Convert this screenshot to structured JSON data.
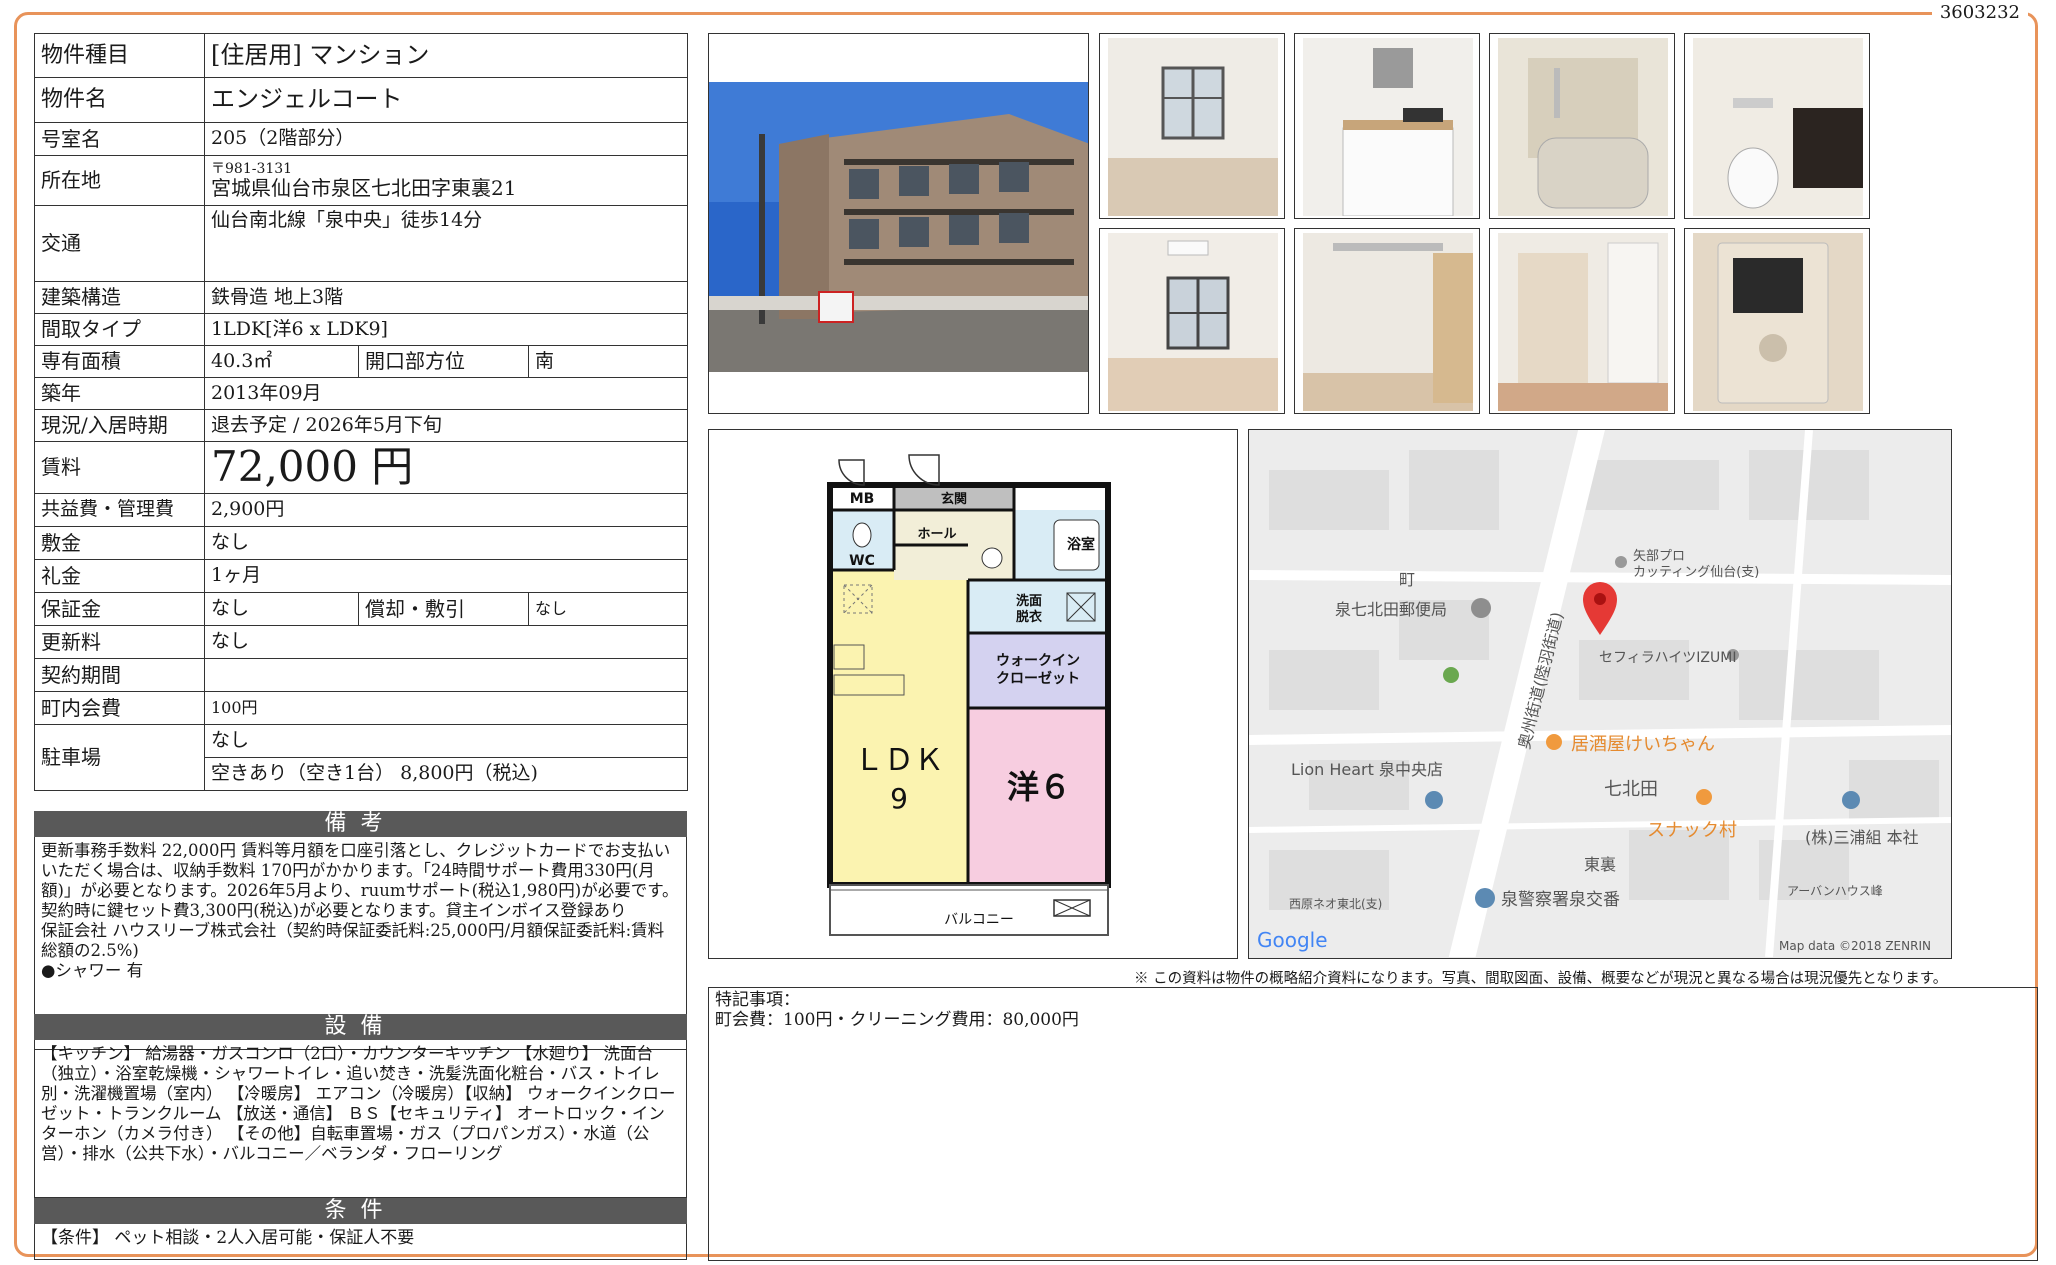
{
  "doc_id": "3603232",
  "spec": {
    "type_label": "物件種目",
    "type_value": "[住居用]  マンション",
    "name_label": "物件名",
    "name_value": "エンジェルコート",
    "room_label": "号室名",
    "room_value": "205（2階部分）",
    "address_label": "所在地",
    "address_zip": "〒981-3131",
    "address_value": "宮城県仙台市泉区七北田字東裏21",
    "access_label": "交通",
    "access_value": "仙台南北線「泉中央」徒歩14分",
    "structure_label": "建築構造",
    "structure_value": "鉄骨造 地上3階",
    "layout_label": "間取タイプ",
    "layout_value": "1LDK[洋6 x LDK9]",
    "area_label": "専有面積",
    "area_value": "40.3㎡",
    "opening_label": "開口部方位",
    "opening_value": "南",
    "built_label": "築年",
    "built_value": "2013年09月",
    "status_label": "現況/入居時期",
    "status_value": "退去予定  /  2026年5月下旬",
    "rent_label": "賃料",
    "rent_value": "72,000 円",
    "fee_label": "共益費・管理費",
    "fee_value": "2,900円",
    "deposit_label": "敷金",
    "deposit_value": "なし",
    "keymoney_label": "礼金",
    "keymoney_value": "1ヶ月",
    "guarantee_label": "保証金",
    "guarantee_value": "なし",
    "amort_label": "償却・敷引",
    "amort_value": "なし",
    "renewal_label": "更新料",
    "renewal_value": "なし",
    "contract_label": "契約期間",
    "contract_value": "",
    "town_label": "町内会費",
    "town_value": "100円",
    "parking_label": "駐車場",
    "parking_value1": "なし",
    "parking_value2": "空きあり（空き1台） 8,800円（税込)"
  },
  "bikou": {
    "title": "備考",
    "text": "更新事務手数料 22,000円 賃料等月額を口座引落とし、クレジットカードでお支払いいただく場合は、収納手数料 170円がかかります。「24時間サポート費用330円(月額)」が必要となります。2026年5月より、ruumサポート(税込1,980円)が必要です。契約時に鍵セット費3,300円(税込)が必要となります。貸主インボイス登録あり",
    "guarantor": "保証会社 ハウスリーブ株式会社（契約時保証委託料:25,000円/月額保証委託料:賃料総額の2.5%)",
    "shower": "●シャワー 有"
  },
  "setsubi": {
    "title": "設備",
    "text": "【キッチン】 給湯器・ガスコンロ（2口）・カウンターキッチン 【水廻り】 洗面台（独立）・浴室乾燥機・シャワートイレ・追い焚き・洗髪洗面化粧台・バス・トイレ別・洗濯機置場（室内） 【冷暖房】 エアコン（冷暖房）【収納】 ウォークインクローゼット・トランクルーム 【放送・通信】 ＢＳ【セキュリティ】 オートロック・インターホン（カメラ付き） 【その他】自転車置場・ガス（プロパンガス）・水道（公営）・排水（公共下水）・バルコニー／ベランダ・フローリング"
  },
  "jouken": {
    "title": "条件",
    "text": "【条件】 ペット相談・2人入居可能・保証人不要"
  },
  "floorplan": {
    "mb": "MB",
    "genkan": "玄関",
    "hall": "ホール",
    "bath": "浴室",
    "wc": "WC",
    "wash": "洗面\n脱衣",
    "closet": "ウォークイン\nクローゼット",
    "ldk": "ＬＤＫ",
    "ldk_size": "9",
    "western": "洋６",
    "balcony": "バルコニー",
    "colors": {
      "ldk": "#fbf3b0",
      "western": "#f7cde0",
      "closet": "#d4d2f0",
      "wet": "#d9ecf5",
      "hall": "#f2eed8"
    }
  },
  "map": {
    "labels": {
      "town": "町",
      "post": "泉七北田郵便局",
      "road": "奥州街道(陸羽街道)",
      "yabe": "矢部プロ\nカッティング仙台(支)",
      "sefira": "セフィラハイツIZUMI",
      "lion": "Lion Heart 泉中央店",
      "izakaya": "居酒屋けいちゃん",
      "nanakita": "七北田",
      "snack": "スナック村",
      "miura": "(株)三浦組 本社",
      "higashiura": "東裏",
      "nishihara": "西原ネオ東北(支)",
      "police": "泉警察署泉交番",
      "urban": "アーバンハウス峰",
      "google": "Google",
      "mapdata": "Map data ©2018 ZENRIN"
    }
  },
  "note": "※ この資料は物件の概略紹介資料になります。写真、間取図面、設備、概要などが現況と異なる場合は現況優先となります。",
  "remarks": {
    "title": "特記事項：",
    "text": "町会費：100円・クリーニング費用：80,000円"
  }
}
